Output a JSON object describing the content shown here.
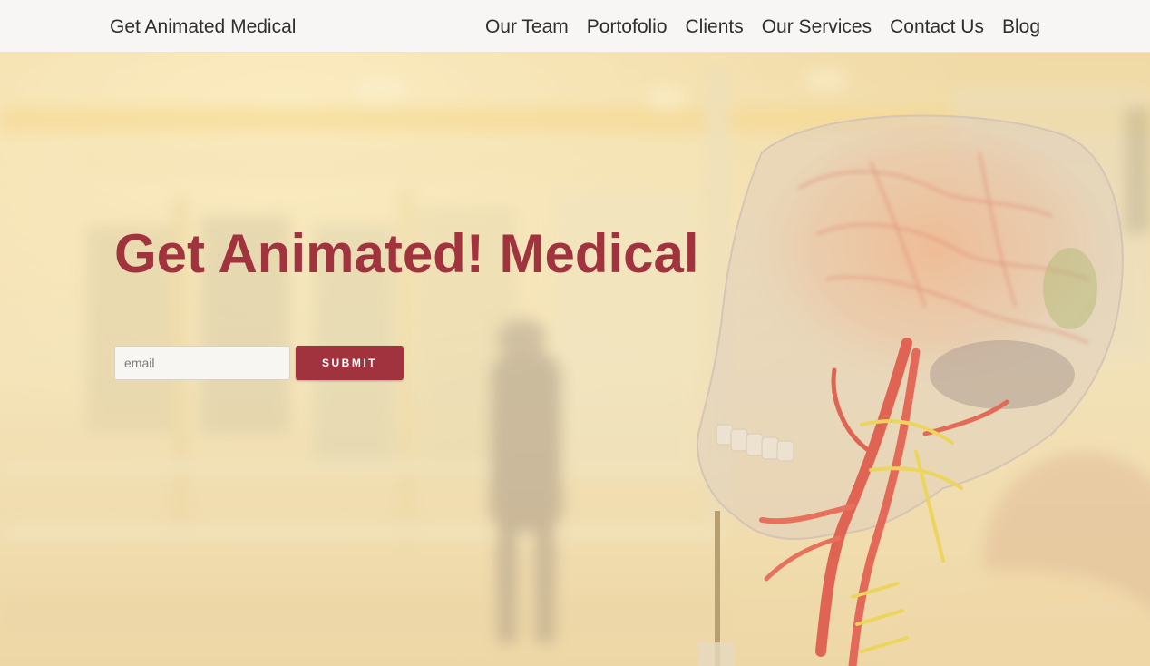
{
  "nav": {
    "brand": "Get Animated Medical",
    "links": [
      "Our Team",
      "Portofolio",
      "Clients",
      "Our Services",
      "Contact Us",
      "Blog"
    ]
  },
  "hero": {
    "title": "Get Animated! Medical",
    "email_placeholder": "email",
    "submit_label": "SUBMIT"
  },
  "colors": {
    "accent": "#a0333d",
    "nav_bg": "#f7f6f4",
    "nav_text": "#2f2f2f"
  }
}
